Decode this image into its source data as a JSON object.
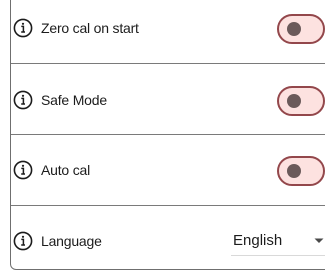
{
  "settings": {
    "rows": [
      {
        "label": "Zero cal on start",
        "control": "toggle",
        "on": false,
        "icon": "info-icon"
      },
      {
        "label": "Safe Mode",
        "control": "toggle",
        "on": false,
        "icon": "info-icon"
      },
      {
        "label": "Auto cal",
        "control": "toggle",
        "on": false,
        "icon": "info-icon"
      },
      {
        "label": "Language",
        "control": "select",
        "value": "English",
        "icon": "info-icon"
      }
    ]
  },
  "colors": {
    "toggle_border": "#93474b",
    "toggle_fill": "#fde2e0",
    "toggle_knob": "#6b5a5a",
    "divider": "#7a7a7a",
    "text": "#1c1c1c"
  }
}
